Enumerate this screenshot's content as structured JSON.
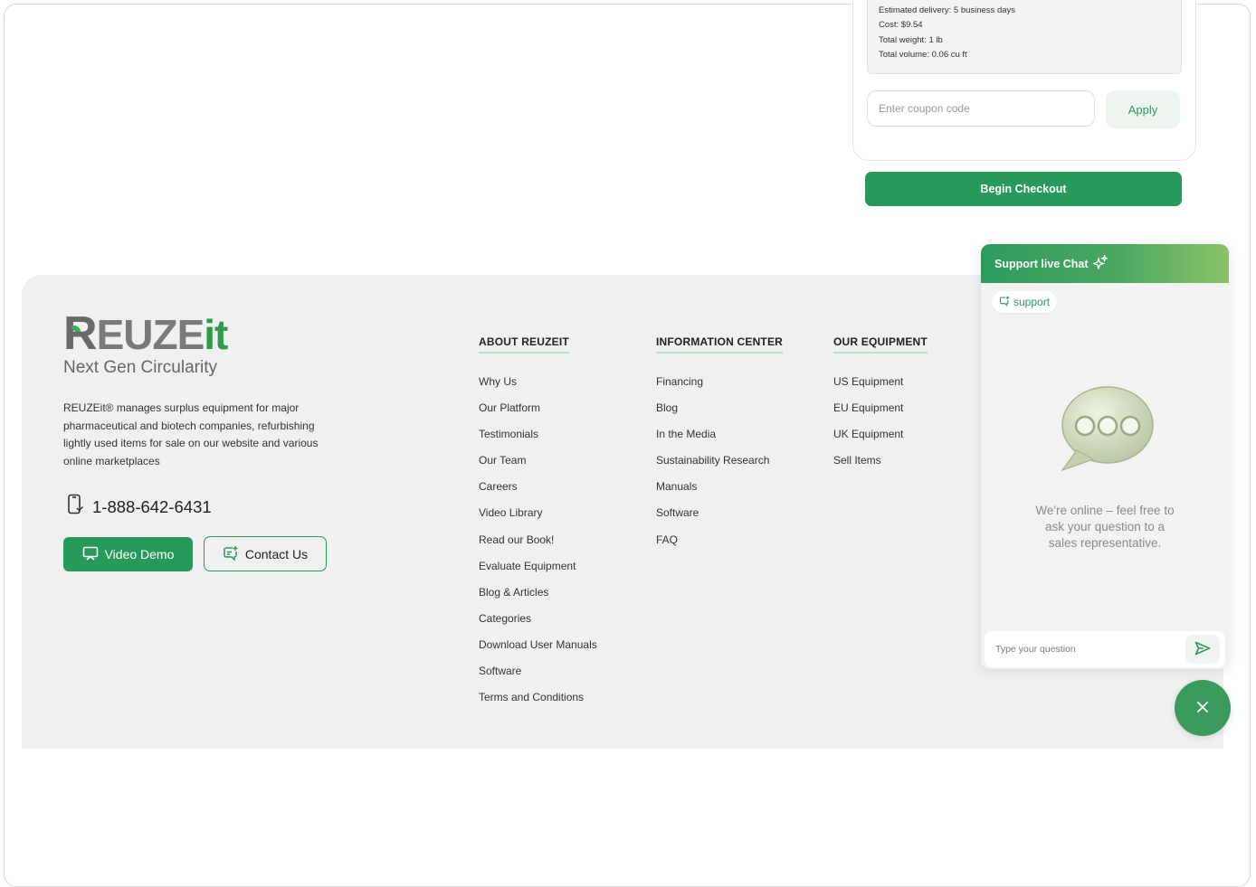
{
  "order_summary": {
    "shipping_lines": [
      "Estimated delivery: 5 business days",
      "Cost: $9.54",
      "Total weight: 1 lb",
      "Total volume: 0.06 cu ft"
    ],
    "coupon_placeholder": "Enter coupon code",
    "apply_label": "Apply",
    "checkout_label": "Begin Checkout"
  },
  "footer": {
    "logo": {
      "wordmark_r": "R",
      "wordmark_mid": "EUZE",
      "wordmark_end": "it",
      "tagline": "Next Gen Circularity"
    },
    "about_text": "REUZEit® manages surplus equipment for major pharmaceutical and biotech companies, refurbishing lightly used items for sale on our website and various online marketplaces",
    "phone": "1-888-642-6431",
    "video_demo_label": "Video Demo",
    "contact_label": "Contact Us",
    "columns": [
      {
        "title": "ABOUT REUZEIT",
        "items": [
          "Why Us",
          "Our Platform",
          "Testimonials",
          "Our Team",
          "Careers",
          "Video Library",
          "Read our Book!",
          "Evaluate Equipment",
          "Blog & Articles",
          "Categories",
          "Download User Manuals",
          "Software",
          "Terms and Conditions"
        ]
      },
      {
        "title": "INFORMATION CENTER",
        "items": [
          "Financing",
          "Blog",
          "In the Media",
          "Sustainability Research",
          "Manuals",
          "Software",
          "FAQ"
        ]
      },
      {
        "title": "OUR EQUIPMENT",
        "items": [
          "US Equipment",
          "EU Equipment",
          "UK Equipment",
          "Sell Items"
        ]
      }
    ]
  },
  "chat": {
    "title": "Support live Chat",
    "tag": "support",
    "message": "We're online – feel free to ask your question to a sales representative.",
    "input_placeholder": "Type your question",
    "close_symbol": "×"
  },
  "colors": {
    "brand_green": "#27995a",
    "footer_bg": "#f0f0f0"
  },
  "icons": [
    "phone-icon",
    "presentation-icon",
    "chat-edit-icon",
    "sparkle-icon",
    "send-icon",
    "close-icon",
    "chat-bubble-icon"
  ]
}
